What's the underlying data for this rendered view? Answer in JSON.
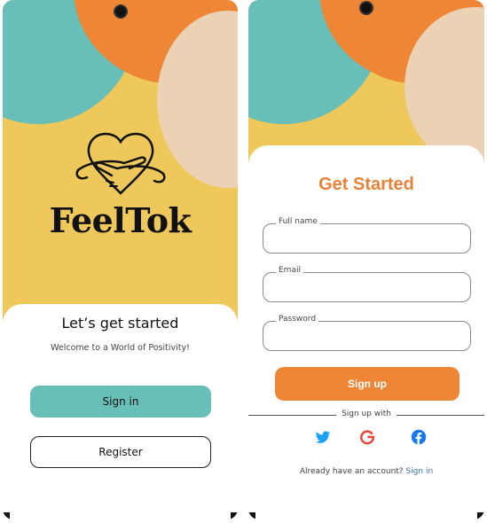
{
  "left_screen": {
    "brand": "FeelTok",
    "title": "Let’s get started",
    "subtitle": "Welcome to a World of Positivity!",
    "signin_label": "Sign in",
    "register_label": "Register"
  },
  "right_screen": {
    "title": "Get Started",
    "fields": [
      {
        "label": "Full name",
        "value": ""
      },
      {
        "label": "Email",
        "value": ""
      },
      {
        "label": "Password",
        "value": ""
      }
    ],
    "signup_label": "Sign up",
    "divider_text": "Sign up with",
    "social_icons": [
      "twitter-icon",
      "google-icon",
      "facebook-icon"
    ],
    "footer_text": "Already have an account?",
    "footer_link": "Sign in"
  },
  "colors": {
    "yellow": "#eec85b",
    "teal": "#68bfb7",
    "orange": "#ee8636",
    "peach": "#ecd2b5",
    "twitter": "#1da1f2",
    "google": "#ea4335",
    "facebook": "#1877f2"
  }
}
